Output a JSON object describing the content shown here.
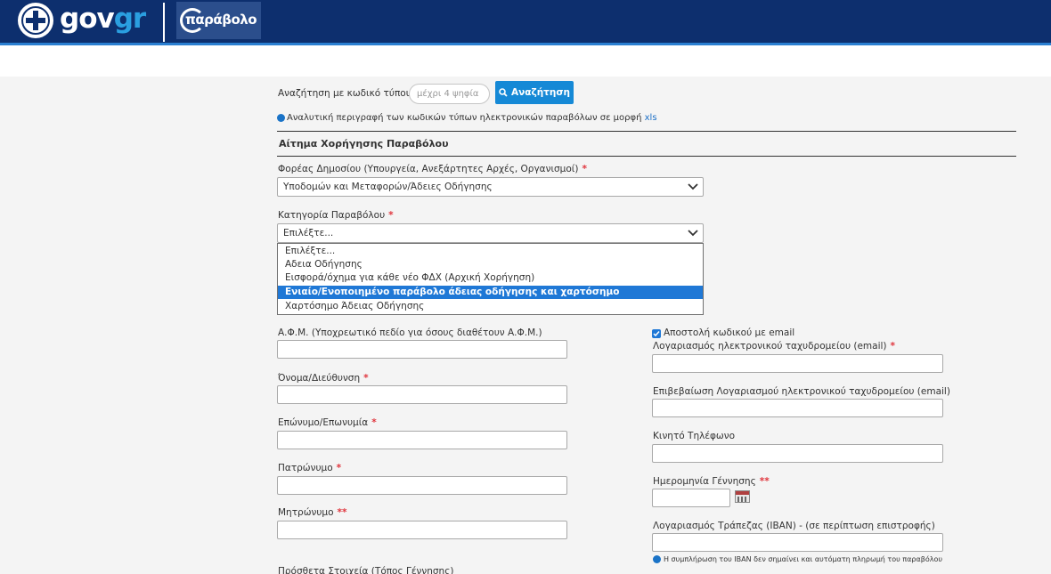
{
  "header": {
    "gov_logo_main": "gov",
    "gov_logo_accent": "gr",
    "parabolo_logo": "παράβολο",
    "colors": {
      "bar": "#0d2f6e",
      "accent_line": "#2a7fd1",
      "gr": "#2a9fe0"
    }
  },
  "search": {
    "label": "Αναζήτηση με κωδικό τύπου",
    "placeholder": "μέχρι 4 ψηφία",
    "button_label": "Αναζήτηση",
    "button_icon": "search-icon",
    "button_color": "#1589d6"
  },
  "info": {
    "description": "Αναλυτική περιγραφή των κωδικών τύπων ηλεκτρονικών παραβόλων σε μορφή",
    "link_text": "xls"
  },
  "section": {
    "title": "Αίτημα Χορήγησης Παραβόλου"
  },
  "form": {
    "agency": {
      "label": "Φορέας Δημοσίου (Υπουργεία, Ανεξάρτητες Αρχές, Οργανισμοί)",
      "required_mark": "*",
      "value": "Υποδομών και Μεταφορών/Άδειες Οδήγησης"
    },
    "category": {
      "label": "Κατηγορία Παραβόλου",
      "required_mark": "*",
      "value": "Επιλέξτε...",
      "options": [
        "Επιλέξτε...",
        "Αδεια Οδήγησης",
        "Εισφορά/όχημα για κάθε νέο ΦΔΧ (Αρχική Χορήγηση)",
        "Ενιαίο/Ενοποιημένο παράβολο άδειας οδήγησης και χαρτόσημο",
        "Χαρτόσημο Άδειας Οδήγησης"
      ],
      "highlighted_option": "Ενιαίο/Ενοποιημένο παράβολο άδειας οδήγησης και χαρτόσημο"
    },
    "afm": {
      "label": "Α.Φ.Μ. (Υποχρεωτικό πεδίο για όσους διαθέτουν Α.Φ.Μ.)",
      "value": ""
    },
    "first_name": {
      "label": "Όνομα/Διεύθυνση",
      "required_mark": "*",
      "value": ""
    },
    "last_name": {
      "label": "Επώνυμο/Επωνυμία",
      "required_mark": "*",
      "value": ""
    },
    "father_name": {
      "label": "Πατρώνυμο",
      "required_mark": "*",
      "value": ""
    },
    "mother_name": {
      "label": "Μητρώνυμο",
      "required_mark": "**",
      "value": ""
    },
    "extra_info": {
      "label": "Πρόσθετα Στοιχεία (Τόπος Γέννησης)"
    },
    "send_code_email": {
      "label": "Αποστολή κωδικού με email",
      "checked": true
    },
    "email": {
      "label": "Λογαριασμός ηλεκτρονικού ταχυδρομείου (email)",
      "required_mark": "*",
      "value": ""
    },
    "email_confirm": {
      "label": "Επιβεβαίωση Λογαριασμού ηλεκτρονικού ταχυδρομείου (email)",
      "value": ""
    },
    "mobile": {
      "label": "Κινητό Τηλέφωνο",
      "value": ""
    },
    "birth_date": {
      "label": "Ημερομηνία Γέννησης",
      "required_mark": "**",
      "value": "",
      "icon": "calendar-icon"
    },
    "iban": {
      "label": "Λογαριασμός Τράπεζας (IBAN) - (σε περίπτωση επιστροφής)",
      "value": "",
      "note": "Η συμπλήρωση του IBAN δεν σημαίνει και αυτόματη πληρωμή του παραβόλου"
    }
  }
}
